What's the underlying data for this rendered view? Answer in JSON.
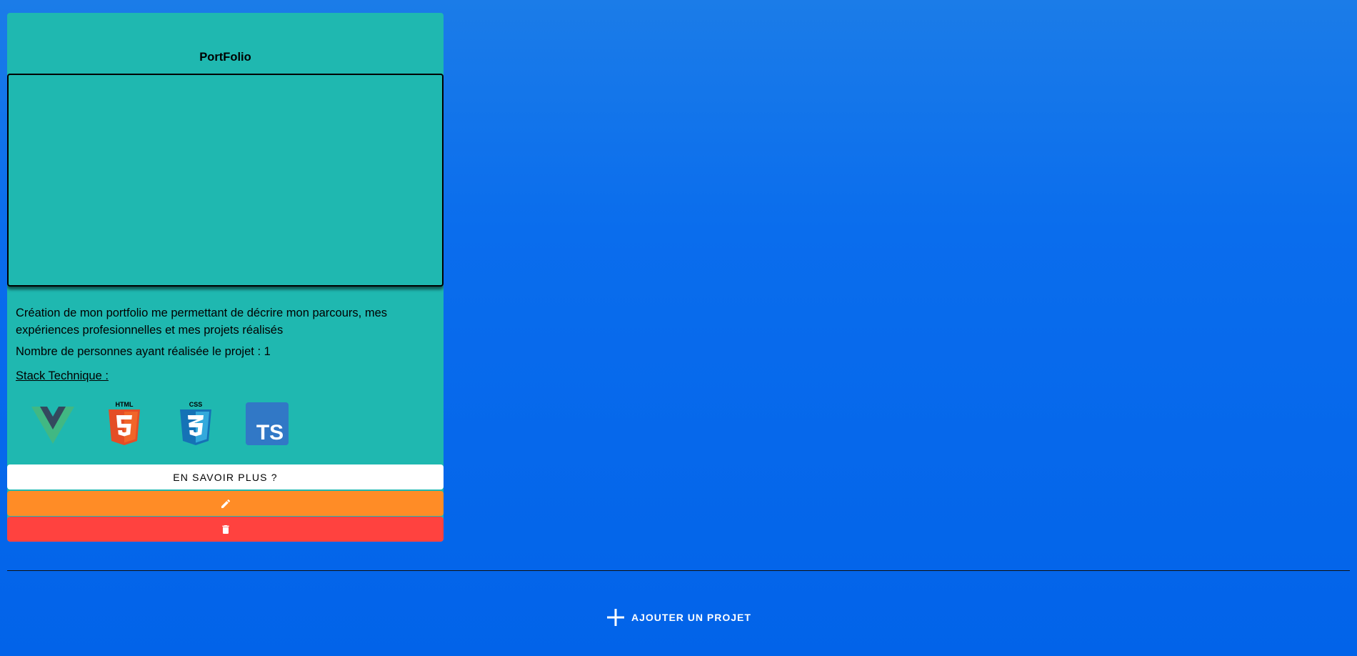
{
  "project_card": {
    "title": "PortFolio",
    "description": "Création de mon portfolio me permettant de décrire mon parcours, mes expériences profesionnelles et mes projets réalisés",
    "people_count": "Nombre de personnes ayant réalisée le projet : 1",
    "stack_label": "Stack Technique :",
    "stack": [
      {
        "name": "vue",
        "icon": "vue-logo-icon",
        "color": "#41b883"
      },
      {
        "name": "html5",
        "icon": "html5-logo-icon",
        "color": "#e44d26",
        "text": "HTML"
      },
      {
        "name": "css3",
        "icon": "css3-logo-icon",
        "color": "#1572b6",
        "text": "CSS"
      },
      {
        "name": "typescript",
        "icon": "typescript-logo-icon",
        "color": "#3178c6",
        "text": "TS"
      }
    ],
    "more_button_label": "EN SAVOIR PLUS ?",
    "edit_button_icon": "pencil-icon",
    "delete_button_icon": "trash-icon"
  },
  "add_project": {
    "label": "AJOUTER UN PROJET",
    "icon": "plus-icon"
  },
  "colors": {
    "card_background": "#1fb8b0",
    "edit_button": "#ff8c26",
    "delete_button": "#ff423f",
    "page_background": "#0a6ded"
  }
}
